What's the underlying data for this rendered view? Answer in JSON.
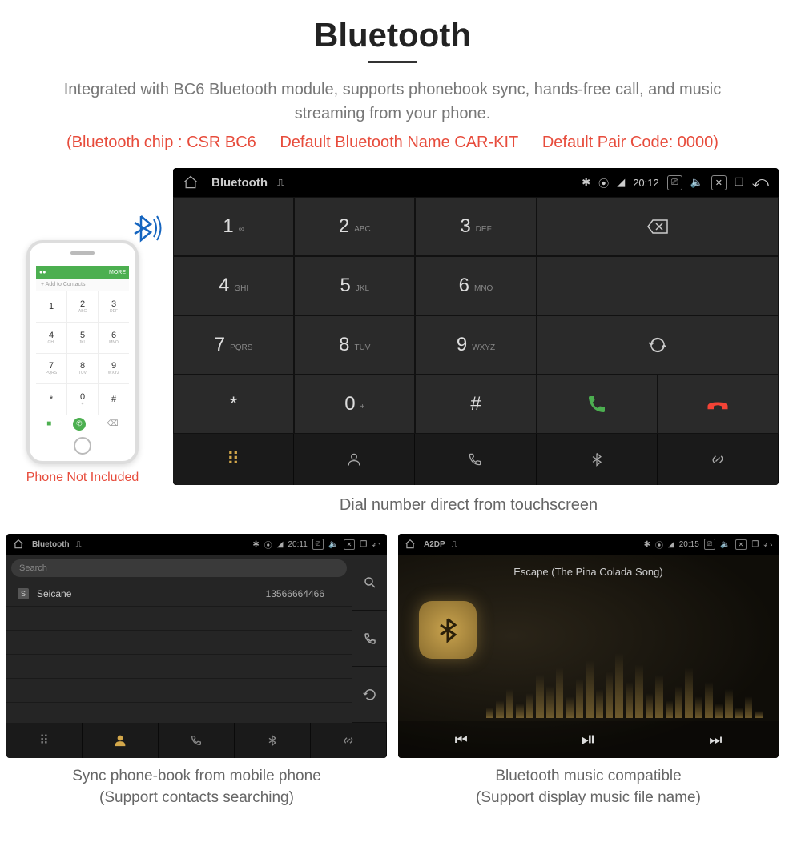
{
  "title": "Bluetooth",
  "description": "Integrated with BC6 Bluetooth module, supports phonebook sync, hands-free call, and music streaming from your phone.",
  "specs": {
    "chip": "(Bluetooth chip : CSR BC6",
    "name": "Default Bluetooth Name CAR-KIT",
    "code": "Default Pair Code: 0000)"
  },
  "phone": {
    "add_contacts": "+  Add to Contacts",
    "more": "MORE",
    "keys": [
      {
        "d": "1",
        "s": ""
      },
      {
        "d": "2",
        "s": "ABC"
      },
      {
        "d": "3",
        "s": "DEF"
      },
      {
        "d": "4",
        "s": "GHI"
      },
      {
        "d": "5",
        "s": "JKL"
      },
      {
        "d": "6",
        "s": "MNO"
      },
      {
        "d": "7",
        "s": "PQRS"
      },
      {
        "d": "8",
        "s": "TUV"
      },
      {
        "d": "9",
        "s": "WXYZ"
      },
      {
        "d": "*",
        "s": ""
      },
      {
        "d": "0",
        "s": "+"
      },
      {
        "d": "#",
        "s": ""
      }
    ],
    "caption": "Phone Not Included"
  },
  "headunit": {
    "title": "Bluetooth",
    "time": "20:12",
    "keys": [
      {
        "d": "1",
        "s": "∞",
        "span": 1
      },
      {
        "d": "2",
        "s": "ABC",
        "span": 1
      },
      {
        "d": "3",
        "s": "DEF",
        "span": 1
      },
      {
        "d": "⌫",
        "s": "",
        "span": 2,
        "cls": ""
      },
      {
        "d": "4",
        "s": "GHI",
        "span": 1
      },
      {
        "d": "5",
        "s": "JKL",
        "span": 1
      },
      {
        "d": "6",
        "s": "MNO",
        "span": 1
      },
      {
        "d": "",
        "s": "",
        "span": 2,
        "cls": ""
      },
      {
        "d": "7",
        "s": "PQRS",
        "span": 1
      },
      {
        "d": "8",
        "s": "TUV",
        "span": 1
      },
      {
        "d": "9",
        "s": "WXYZ",
        "span": 1
      },
      {
        "d": "⟳",
        "s": "",
        "span": 2,
        "cls": ""
      },
      {
        "d": "*",
        "s": "",
        "span": 1
      },
      {
        "d": "0",
        "s": "+",
        "span": 1
      },
      {
        "d": "#",
        "s": "",
        "span": 1
      },
      {
        "d": "📞",
        "s": "",
        "span": 1,
        "cls": "green"
      },
      {
        "d": "☎",
        "s": "",
        "span": 1,
        "cls": "red"
      }
    ],
    "caption": "Dial number direct from touchscreen"
  },
  "contacts": {
    "title": "Bluetooth",
    "time": "20:11",
    "search": "Search",
    "rows": [
      {
        "badge": "S",
        "name": "Seicane",
        "num": "13566664466"
      }
    ],
    "caption1": "Sync phone-book from mobile phone",
    "caption2": "(Support contacts searching)"
  },
  "music": {
    "title": "A2DP",
    "time": "20:15",
    "song": "Escape (The Pina Colada Song)",
    "caption1": "Bluetooth music compatible",
    "caption2": "(Support display music file name)"
  }
}
